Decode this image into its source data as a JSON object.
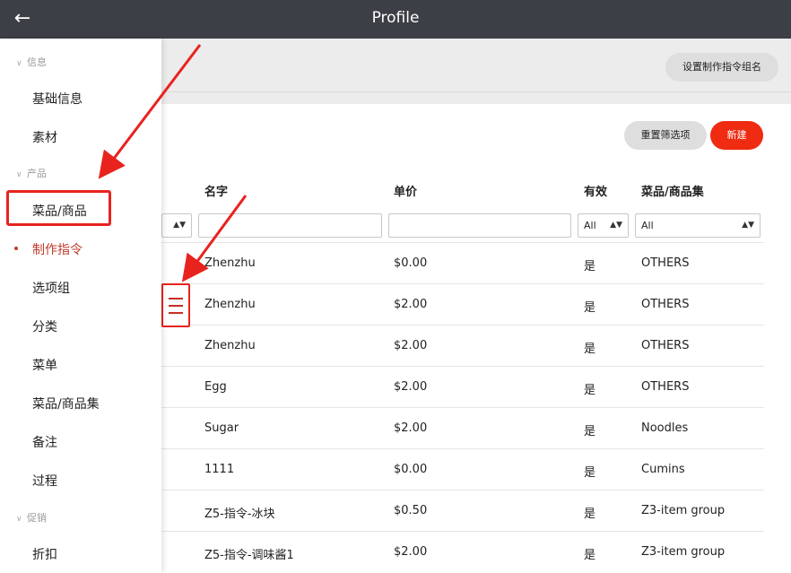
{
  "header": {
    "title": "Profile",
    "back_icon": "arrow-left-icon"
  },
  "sidebar": {
    "sections": [
      {
        "label": "信息",
        "items": [
          "基础信息",
          "素材"
        ]
      },
      {
        "label": "产品",
        "items": [
          "菜品/商品",
          "制作指令",
          "选项组",
          "分类",
          "菜单",
          "菜品/商品集",
          "备注",
          "过程"
        ]
      },
      {
        "label": "促销",
        "items": [
          "折扣"
        ]
      }
    ],
    "active_item": "制作指令"
  },
  "toolbar": {
    "set_group_name": "设置制作指令组名",
    "reset_filters": "重置筛选项",
    "new": "新建"
  },
  "table": {
    "columns": [
      "名字",
      "单价",
      "有效",
      "菜品/商品集"
    ],
    "filters": {
      "valid": "All",
      "collection": "All"
    },
    "rows": [
      {
        "name": "Zhenzhu",
        "price": "$0.00",
        "valid": "是",
        "collection": "OTHERS"
      },
      {
        "name": "Zhenzhu",
        "price": "$2.00",
        "valid": "是",
        "collection": "OTHERS"
      },
      {
        "name": "Zhenzhu",
        "price": "$2.00",
        "valid": "是",
        "collection": "OTHERS"
      },
      {
        "name": "Egg",
        "price": "$2.00",
        "valid": "是",
        "collection": "OTHERS"
      },
      {
        "name": "Sugar",
        "price": "$2.00",
        "valid": "是",
        "collection": "Noodles"
      },
      {
        "name": "1111",
        "price": "$0.00",
        "valid": "是",
        "collection": "Cumins"
      },
      {
        "name": "Z5-指令-冰块",
        "price": "$0.50",
        "valid": "是",
        "collection": "Z3-item group"
      },
      {
        "name": "Z5-指令-调味酱1",
        "price": "$2.00",
        "valid": "是",
        "collection": "Z3-item group"
      }
    ]
  },
  "colors": {
    "accent": "#ef2b12",
    "active_nav": "#c0392b",
    "annotation": "#e8231e",
    "topbar": "#3c3f45"
  }
}
